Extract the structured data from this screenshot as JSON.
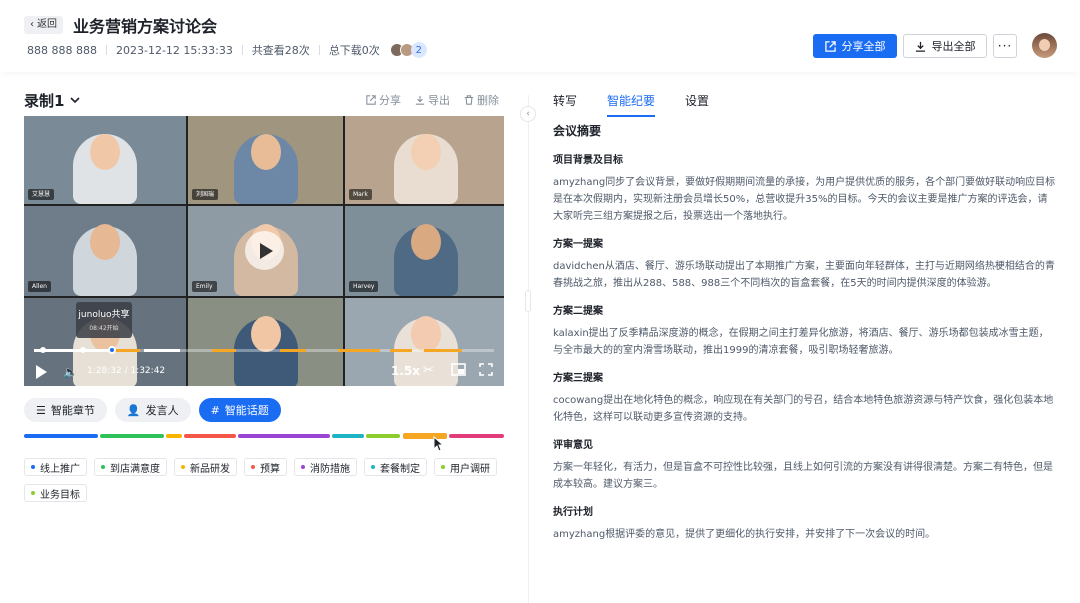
{
  "header": {
    "back_label": "返回",
    "title": "业务营销方案讨论会",
    "meta": {
      "id": "888 888 888",
      "datetime": "2023-12-12 15:33:33",
      "views": "共查看28次",
      "downloads": "总下载0次",
      "viewer_count": "2"
    },
    "share_all": "分享全部",
    "export_all": "导出全部",
    "more": "···"
  },
  "recording": {
    "title": "录制1",
    "actions": {
      "share": "分享",
      "export": "导出",
      "delete": "删除"
    }
  },
  "video": {
    "participants": [
      {
        "name": "艾慧慧",
        "bg": "#7a8a96"
      },
      {
        "name": "刘国瑞",
        "bg": "#a09680"
      },
      {
        "name": "Mark",
        "bg": "#b8a48e"
      },
      {
        "name": "Allen",
        "bg": "#6f7d8a"
      },
      {
        "name": "Emily",
        "bg": "#8e9aa4"
      },
      {
        "name": "Harvey",
        "bg": "#7f8f99"
      },
      {
        "name": "",
        "bg": "#66727d"
      },
      {
        "name": "",
        "bg": "#8a8f84"
      },
      {
        "name": "",
        "bg": "#9aa6b0"
      }
    ],
    "tooltip": {
      "title": "junoluo共享",
      "sub": "08:42开始"
    },
    "current_time": "1:28:32 / 1:32:42",
    "speed": "1.5x",
    "progress": 0.17
  },
  "views": {
    "chapters": "智能章节",
    "speaker": "发言人",
    "topics": "智能话题"
  },
  "topics": [
    {
      "label": "线上推广",
      "color": "#1a6cf3"
    },
    {
      "label": "到店满意度",
      "color": "#2fc25b"
    },
    {
      "label": "新品研发",
      "color": "#f7b500"
    },
    {
      "label": "预算",
      "color": "#f5564a"
    },
    {
      "label": "消防措施",
      "color": "#9b45d6"
    },
    {
      "label": "套餐制定",
      "color": "#1fb4c4"
    },
    {
      "label": "用户调研",
      "color": "#8ccc2c"
    },
    {
      "label": "业务目标",
      "color": "#8ccc2c"
    }
  ],
  "panel": {
    "tabs": [
      "转写",
      "智能纪要",
      "设置"
    ],
    "summary_title": "会议摘要",
    "sections": [
      {
        "title": "项目背景及目标",
        "body": "amyzhang同步了会议背景，要做好假期期间流量的承接，为用户提供优质的服务，各个部门要做好联动响应目标是在本次假期内，实现新注册会员增长50%，总营收提升35%的目标。今天的会议主要是推广方案的评选会，请大家听完三组方案提报之后，投票选出一个落地执行。"
      },
      {
        "title": "方案一提案",
        "body": "davidchen从酒店、餐厅、游乐场联动提出了本期推广方案，主要面向年轻群体，主打与近期网络热梗相结合的青春挑战之旅，推出从288、588、988三个不同档次的盲盒套餐，在5天的时间内提供深度的体验游。"
      },
      {
        "title": "方案二提案",
        "body": "kalaxin提出了反季精品深度游的概念，在假期之间主打差异化旅游，将酒店、餐厅、游乐场都包装成冰雪主题，与全市最大的的室内滑雪场联动，推出1999的清凉套餐，吸引职场轻奢旅游。"
      },
      {
        "title": "方案三提案",
        "body": "cocowang提出在地化特色的概念，响应现在有关部门的号召，结合本地特色旅游资源与特产饮食，强化包装本地化特色，这样可以联动更多宣传资源的支持。"
      },
      {
        "title": "评审意见",
        "body": "方案一年轻化，有活力，但是盲盒不可控性比较强，且线上如何引流的方案没有讲得很清楚。方案二有特色，但是成本较高。建议方案三。"
      },
      {
        "title": "执行计划",
        "body": "amyzhang根据评委的意见，提供了更细化的执行安排，并安排了下一次会议的时间。"
      }
    ]
  }
}
